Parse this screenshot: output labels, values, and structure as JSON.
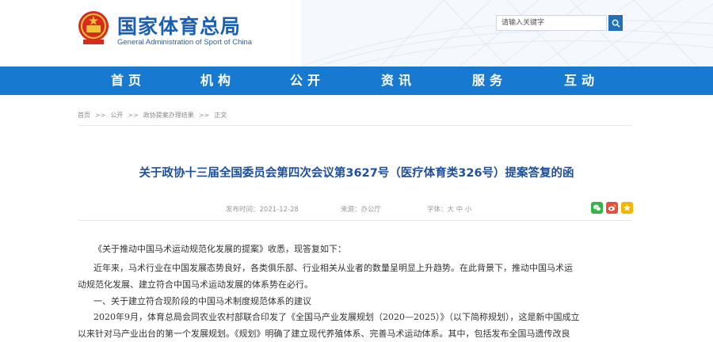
{
  "header": {
    "logo_cn": "国家体育总局",
    "logo_en": "General Administration of Sport of China",
    "search_placeholder": "请输入关键字"
  },
  "nav": {
    "items": [
      "首页",
      "机构",
      "公开",
      "资讯",
      "服务",
      "互动"
    ]
  },
  "breadcrumb": [
    "首页",
    "公开",
    "政协提案办理结果",
    "正文"
  ],
  "article": {
    "title": "关于政协十三届全国委员会第四次会议第3627号（医疗体育类326号）提案答复的函",
    "date": "发布时间：2021-12-28",
    "source": "来源：办公厅",
    "font_size": "字体：大 中 小",
    "paragraphs": [
      "《关于推动中国马术运动规范化发展的提案》收悉，现答复如下：",
      "近年来，马术行业在中国发展态势良好，各类俱乐部、行业相关从业者的数量呈明显上升趋势。在此背景下，推动中国马术运",
      "动规范化发展、建立符合中国马术运动发展的体系势在必行。",
      "一、关于建立符合现阶段的中国马术制度规范体系的建议",
      "2020年9月，体育总局会同农业农村部联合印发了《全国马产业发展规划（2020—2025）》（以下简称规划），这是新中国成立",
      "以来针对马产业出台的第一个发展规划。《规划》明确了建立现代养殖体系、完善马术运动体系。其中，包括发布全国马遗传改良"
    ]
  },
  "share": {
    "wechat_icon": "wechat-icon",
    "weibo_icon": "weibo-icon",
    "qzone_icon": "qzone-icon"
  },
  "colors": {
    "nav_bg": "#1879d1",
    "title": "#1d4f9e",
    "logo": "#1a5fb4"
  }
}
